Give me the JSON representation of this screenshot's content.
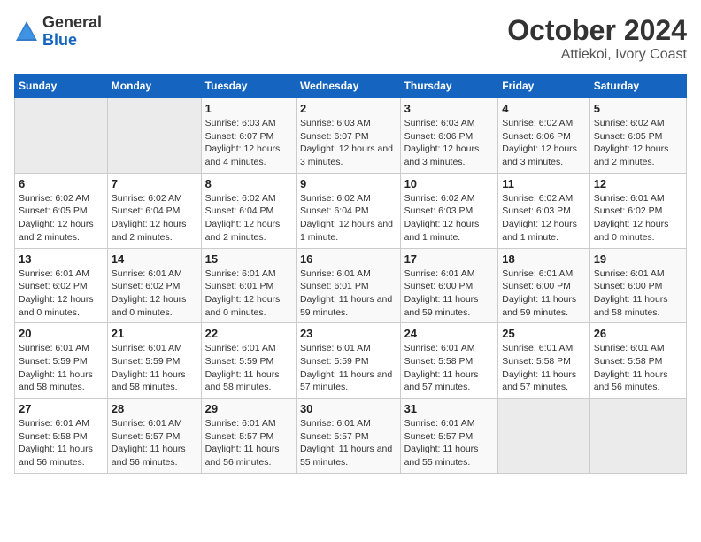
{
  "header": {
    "logo_general": "General",
    "logo_blue": "Blue",
    "title": "October 2024",
    "subtitle": "Attiekoi, Ivory Coast"
  },
  "weekdays": [
    "Sunday",
    "Monday",
    "Tuesday",
    "Wednesday",
    "Thursday",
    "Friday",
    "Saturday"
  ],
  "weeks": [
    [
      {
        "day": "",
        "empty": true
      },
      {
        "day": "",
        "empty": true
      },
      {
        "day": "1",
        "sunrise": "Sunrise: 6:03 AM",
        "sunset": "Sunset: 6:07 PM",
        "daylight": "Daylight: 12 hours and 4 minutes."
      },
      {
        "day": "2",
        "sunrise": "Sunrise: 6:03 AM",
        "sunset": "Sunset: 6:07 PM",
        "daylight": "Daylight: 12 hours and 3 minutes."
      },
      {
        "day": "3",
        "sunrise": "Sunrise: 6:03 AM",
        "sunset": "Sunset: 6:06 PM",
        "daylight": "Daylight: 12 hours and 3 minutes."
      },
      {
        "day": "4",
        "sunrise": "Sunrise: 6:02 AM",
        "sunset": "Sunset: 6:06 PM",
        "daylight": "Daylight: 12 hours and 3 minutes."
      },
      {
        "day": "5",
        "sunrise": "Sunrise: 6:02 AM",
        "sunset": "Sunset: 6:05 PM",
        "daylight": "Daylight: 12 hours and 2 minutes."
      }
    ],
    [
      {
        "day": "6",
        "sunrise": "Sunrise: 6:02 AM",
        "sunset": "Sunset: 6:05 PM",
        "daylight": "Daylight: 12 hours and 2 minutes."
      },
      {
        "day": "7",
        "sunrise": "Sunrise: 6:02 AM",
        "sunset": "Sunset: 6:04 PM",
        "daylight": "Daylight: 12 hours and 2 minutes."
      },
      {
        "day": "8",
        "sunrise": "Sunrise: 6:02 AM",
        "sunset": "Sunset: 6:04 PM",
        "daylight": "Daylight: 12 hours and 2 minutes."
      },
      {
        "day": "9",
        "sunrise": "Sunrise: 6:02 AM",
        "sunset": "Sunset: 6:04 PM",
        "daylight": "Daylight: 12 hours and 1 minute."
      },
      {
        "day": "10",
        "sunrise": "Sunrise: 6:02 AM",
        "sunset": "Sunset: 6:03 PM",
        "daylight": "Daylight: 12 hours and 1 minute."
      },
      {
        "day": "11",
        "sunrise": "Sunrise: 6:02 AM",
        "sunset": "Sunset: 6:03 PM",
        "daylight": "Daylight: 12 hours and 1 minute."
      },
      {
        "day": "12",
        "sunrise": "Sunrise: 6:01 AM",
        "sunset": "Sunset: 6:02 PM",
        "daylight": "Daylight: 12 hours and 0 minutes."
      }
    ],
    [
      {
        "day": "13",
        "sunrise": "Sunrise: 6:01 AM",
        "sunset": "Sunset: 6:02 PM",
        "daylight": "Daylight: 12 hours and 0 minutes."
      },
      {
        "day": "14",
        "sunrise": "Sunrise: 6:01 AM",
        "sunset": "Sunset: 6:02 PM",
        "daylight": "Daylight: 12 hours and 0 minutes."
      },
      {
        "day": "15",
        "sunrise": "Sunrise: 6:01 AM",
        "sunset": "Sunset: 6:01 PM",
        "daylight": "Daylight: 12 hours and 0 minutes."
      },
      {
        "day": "16",
        "sunrise": "Sunrise: 6:01 AM",
        "sunset": "Sunset: 6:01 PM",
        "daylight": "Daylight: 11 hours and 59 minutes."
      },
      {
        "day": "17",
        "sunrise": "Sunrise: 6:01 AM",
        "sunset": "Sunset: 6:00 PM",
        "daylight": "Daylight: 11 hours and 59 minutes."
      },
      {
        "day": "18",
        "sunrise": "Sunrise: 6:01 AM",
        "sunset": "Sunset: 6:00 PM",
        "daylight": "Daylight: 11 hours and 59 minutes."
      },
      {
        "day": "19",
        "sunrise": "Sunrise: 6:01 AM",
        "sunset": "Sunset: 6:00 PM",
        "daylight": "Daylight: 11 hours and 58 minutes."
      }
    ],
    [
      {
        "day": "20",
        "sunrise": "Sunrise: 6:01 AM",
        "sunset": "Sunset: 5:59 PM",
        "daylight": "Daylight: 11 hours and 58 minutes."
      },
      {
        "day": "21",
        "sunrise": "Sunrise: 6:01 AM",
        "sunset": "Sunset: 5:59 PM",
        "daylight": "Daylight: 11 hours and 58 minutes."
      },
      {
        "day": "22",
        "sunrise": "Sunrise: 6:01 AM",
        "sunset": "Sunset: 5:59 PM",
        "daylight": "Daylight: 11 hours and 58 minutes."
      },
      {
        "day": "23",
        "sunrise": "Sunrise: 6:01 AM",
        "sunset": "Sunset: 5:59 PM",
        "daylight": "Daylight: 11 hours and 57 minutes."
      },
      {
        "day": "24",
        "sunrise": "Sunrise: 6:01 AM",
        "sunset": "Sunset: 5:58 PM",
        "daylight": "Daylight: 11 hours and 57 minutes."
      },
      {
        "day": "25",
        "sunrise": "Sunrise: 6:01 AM",
        "sunset": "Sunset: 5:58 PM",
        "daylight": "Daylight: 11 hours and 57 minutes."
      },
      {
        "day": "26",
        "sunrise": "Sunrise: 6:01 AM",
        "sunset": "Sunset: 5:58 PM",
        "daylight": "Daylight: 11 hours and 56 minutes."
      }
    ],
    [
      {
        "day": "27",
        "sunrise": "Sunrise: 6:01 AM",
        "sunset": "Sunset: 5:58 PM",
        "daylight": "Daylight: 11 hours and 56 minutes."
      },
      {
        "day": "28",
        "sunrise": "Sunrise: 6:01 AM",
        "sunset": "Sunset: 5:57 PM",
        "daylight": "Daylight: 11 hours and 56 minutes."
      },
      {
        "day": "29",
        "sunrise": "Sunrise: 6:01 AM",
        "sunset": "Sunset: 5:57 PM",
        "daylight": "Daylight: 11 hours and 56 minutes."
      },
      {
        "day": "30",
        "sunrise": "Sunrise: 6:01 AM",
        "sunset": "Sunset: 5:57 PM",
        "daylight": "Daylight: 11 hours and 55 minutes."
      },
      {
        "day": "31",
        "sunrise": "Sunrise: 6:01 AM",
        "sunset": "Sunset: 5:57 PM",
        "daylight": "Daylight: 11 hours and 55 minutes."
      },
      {
        "day": "",
        "empty": true
      },
      {
        "day": "",
        "empty": true
      }
    ]
  ]
}
